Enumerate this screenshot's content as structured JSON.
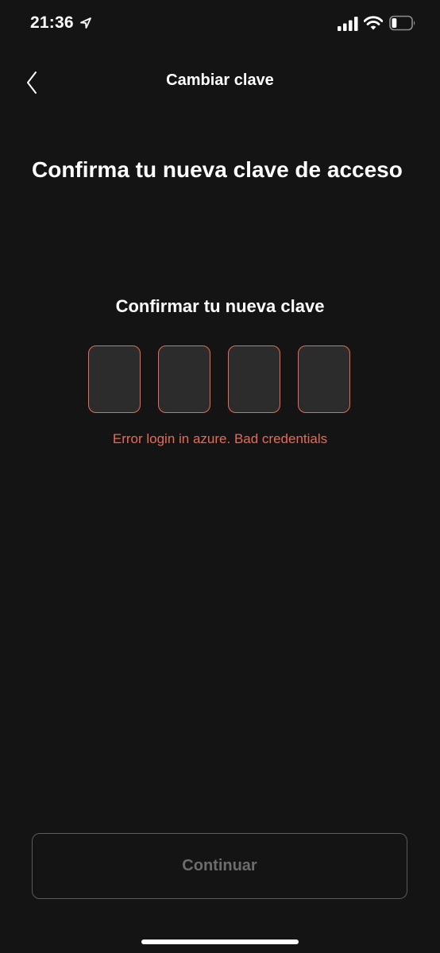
{
  "status_bar": {
    "time": "21:36",
    "icons": [
      "location-arrow-icon",
      "cellular-signal-icon",
      "wifi-icon",
      "battery-icon"
    ],
    "battery_level": 0.25
  },
  "nav": {
    "back_icon": "chevron-left-icon",
    "title": "Cambiar clave"
  },
  "heading": "Confirma tu nueva clave de acceso",
  "pin": {
    "label": "Confirmar tu nueva clave",
    "digit_count": 4,
    "values": [
      "",
      "",
      "",
      ""
    ],
    "error": "Error login in azure. Bad credentials"
  },
  "continue_label": "Continuar",
  "colors": {
    "background": "#141414",
    "error": "#e86a55",
    "pin_fill": "#2c2c2c",
    "button_border": "#5a5a5a",
    "button_text_disabled": "#6c6c6c"
  }
}
